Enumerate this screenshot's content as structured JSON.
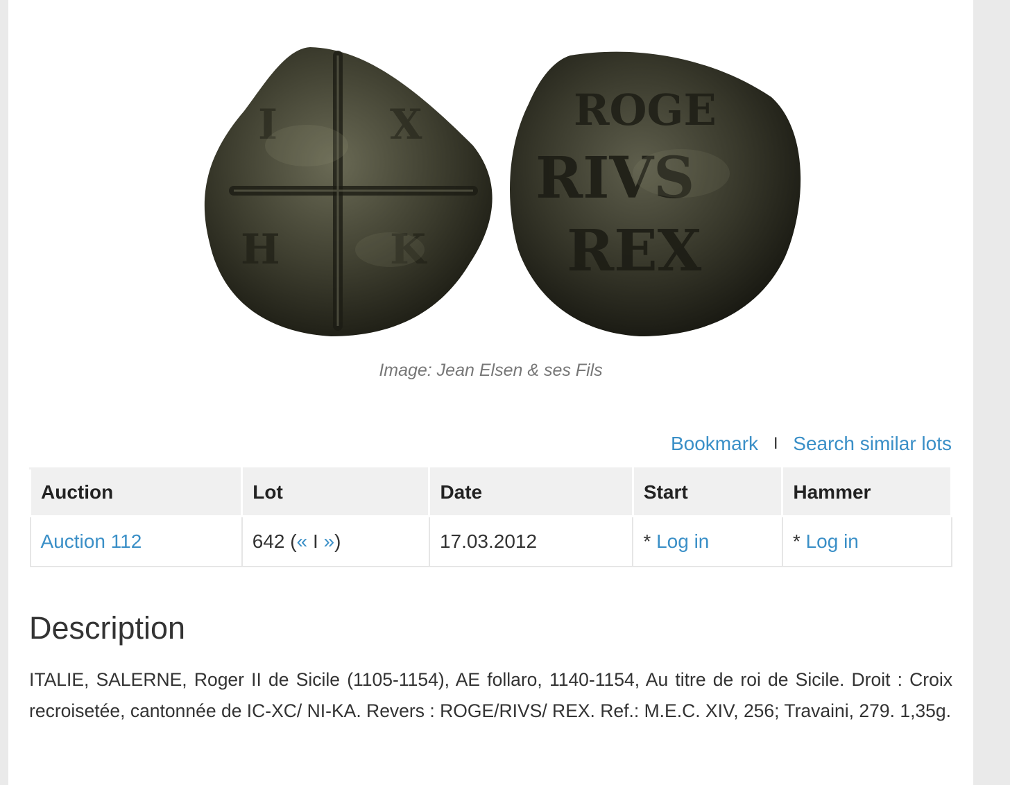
{
  "coin_image": {
    "caption": "Image: Jean Elsen & ses Fils",
    "reverse_legend": [
      "ROGE",
      "RIVS",
      "REX"
    ]
  },
  "actions": {
    "bookmark": "Bookmark",
    "separator": "I",
    "search_similar": "Search similar lots"
  },
  "table": {
    "headers": [
      "Auction",
      "Lot",
      "Date",
      "Start",
      "Hammer"
    ],
    "row": {
      "auction": "Auction 112",
      "lot_number": "642",
      "lot_prev": "«",
      "lot_sep": "I",
      "lot_next": "»",
      "date": "17.03.2012",
      "start_prefix": "* ",
      "start_link": "Log in",
      "hammer_prefix": "* ",
      "hammer_link": "Log in"
    }
  },
  "description": {
    "title": "Description",
    "text": "ITALIE, SALERNE, Roger II de Sicile (1105-1154), AE follaro, 1140-1154, Au titre de roi de Sicile. Droit : Croix recroisetée, cantonnée de IC-XC/ NI-KA. Revers : ROGE/RIVS/ REX. Ref.: M.E.C. XIV, 256; Travaini, 279. 1,35g."
  },
  "colors": {
    "link": "#3a8fc7",
    "header_bg": "#f0f0f0",
    "caption": "#777777"
  }
}
